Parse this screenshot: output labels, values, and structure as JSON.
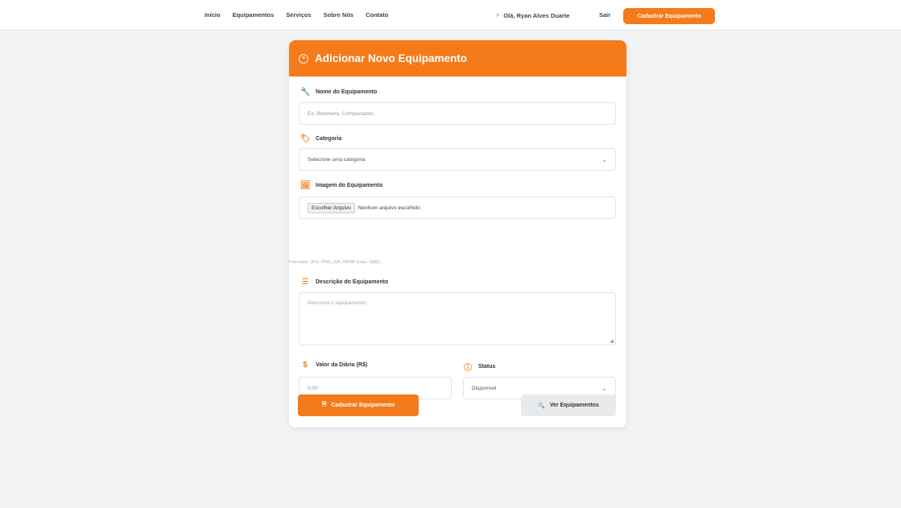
{
  "nav": {
    "items": [
      "Início",
      "Equipamentos",
      "Serviços",
      "Sobre Nós",
      "Contato"
    ],
    "user_greeting": "Olá, Ryan Alves Duarte",
    "logout": "Sair",
    "cta": "Cadastrar Equipamento"
  },
  "form": {
    "title": "Adicionar Novo Equipamento",
    "name_label": "Nome do Equipamento",
    "name_placeholder": "Ex: Betoneira, Compactador...",
    "category_label": "Categoria",
    "category_value": "Selecione uma categoria",
    "image_label": "Imagem do Equipamento",
    "file_button": "Escolher Arquivo",
    "file_status": "Nenhum arquivo escolhido",
    "image_hint": "Formatos: JPG, PNG, GIF, WEBP (max. 5MB)",
    "description_label": "Descrição do Equipamento",
    "description_placeholder": "Descreva o equipamento...",
    "price_label": "Valor da Diária (R$)",
    "price_placeholder": "0,00",
    "status_label": "Status",
    "status_value": "Disponível",
    "submit": "Cadastrar Equipamento",
    "view": "Ver Equipamentos"
  },
  "colors": {
    "accent": "#f47a1a",
    "background": "#f2f3f5"
  }
}
